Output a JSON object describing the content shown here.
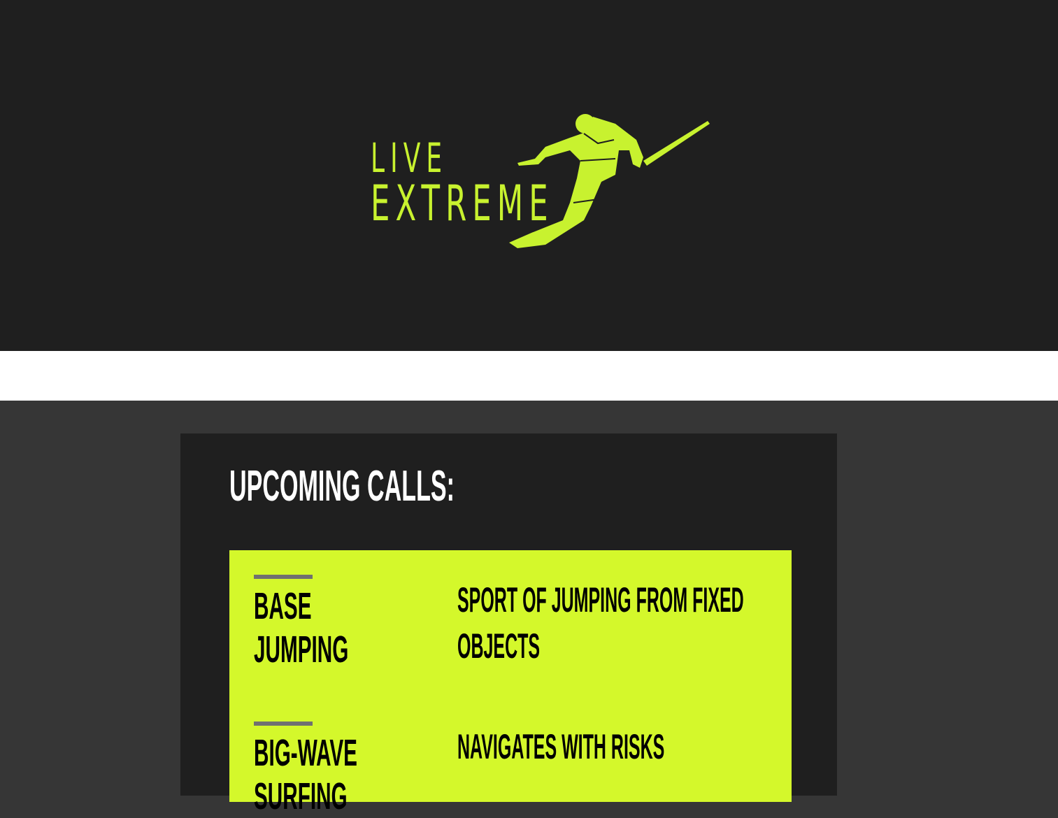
{
  "logo": {
    "line1": "LIVE",
    "line2": "EXTREME",
    "icon": "skier-icon",
    "color": "#c8f22f"
  },
  "upcoming": {
    "heading": "UPCOMING CALLS:",
    "accent": "#d4f82b",
    "items": [
      {
        "title_line1": "BASE",
        "title_line2": "JUMPING",
        "description": "SPORT OF JUMPING FROM FIXED OBJECTS"
      },
      {
        "title_line1": "BIG-WAVE",
        "title_line2": "SURFING",
        "description": "NAVIGATES WITH RISKS"
      }
    ]
  }
}
